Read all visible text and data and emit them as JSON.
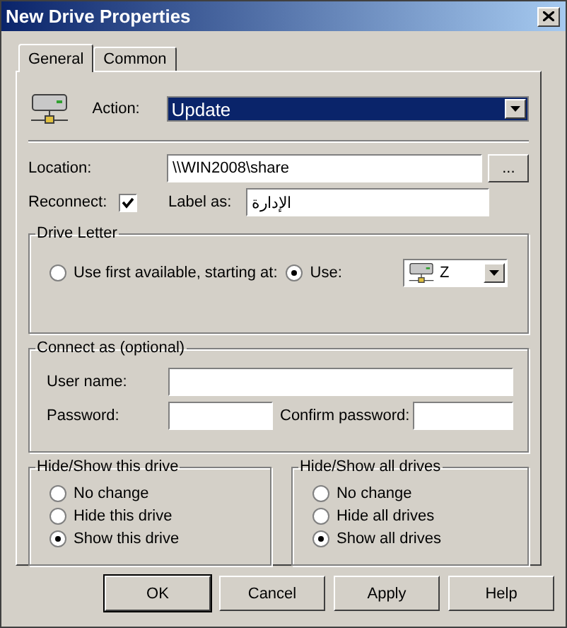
{
  "window": {
    "title": "New Drive Properties"
  },
  "tabs": [
    {
      "label": "General",
      "selected": true
    },
    {
      "label": "Common",
      "selected": false
    }
  ],
  "action": {
    "label": "Action:",
    "value": "Update"
  },
  "location": {
    "label": "Location:",
    "value": "\\\\WIN2008\\share",
    "browse": "..."
  },
  "reconnect": {
    "label": "Reconnect:",
    "checked": true
  },
  "label_as": {
    "label": "Label as:",
    "value": "الإدارة"
  },
  "drive_letter": {
    "title": "Drive Letter",
    "options": [
      {
        "label": "Use first available, starting at:",
        "selected": false
      },
      {
        "label": "Use:",
        "selected": true
      }
    ],
    "drive": "Z"
  },
  "connect_as": {
    "title": "Connect as (optional)",
    "user_label": "User name:",
    "password_label": "Password:",
    "confirm_label": "Confirm password:"
  },
  "hide_this": {
    "title": "Hide/Show this drive",
    "options": [
      {
        "label": "No change",
        "selected": false
      },
      {
        "label": "Hide this drive",
        "selected": false
      },
      {
        "label": "Show this drive",
        "selected": true
      }
    ]
  },
  "hide_all": {
    "title": "Hide/Show all drives",
    "options": [
      {
        "label": "No change",
        "selected": false
      },
      {
        "label": "Hide all drives",
        "selected": false
      },
      {
        "label": "Show all drives",
        "selected": true
      }
    ]
  },
  "buttons": [
    {
      "label": "OK",
      "default": true
    },
    {
      "label": "Cancel",
      "default": false
    },
    {
      "label": "Apply",
      "default": false
    },
    {
      "label": "Help",
      "default": false
    }
  ]
}
